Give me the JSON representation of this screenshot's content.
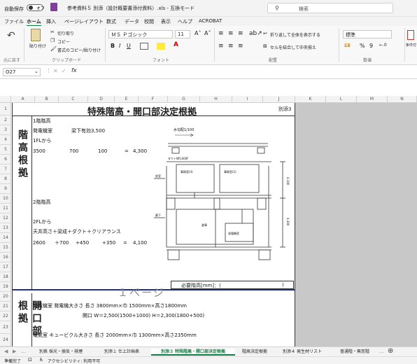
{
  "titlebar": {
    "autosave_label": "自動保存",
    "autosave_state": "オフ",
    "filename": "参考資料５ 別添（設計概要書添付資料）.xls  -  互換モード",
    "search_placeholder": "検索"
  },
  "menu": [
    "ファイル",
    "ホーム",
    "挿入",
    "ページレイアウト",
    "数式",
    "データ",
    "校閲",
    "表示",
    "ヘルプ",
    "ACROBAT"
  ],
  "ribbon": {
    "undo_label": "元に戻す",
    "paste_label": "貼り付け",
    "cut_label": "切り取り",
    "copy_label": "コピー",
    "format_painter_label": "書式のコピー/貼り付け",
    "clipboard_label": "クリップボード",
    "font_name": "ＭＳ Ｐゴシック",
    "font_size": "11",
    "font_label": "フォント",
    "bold": "B",
    "italic": "I",
    "underline": "U",
    "wrap_label": "折り返して全体を表示する",
    "merge_label": "セルを結合して中央揃え",
    "align_label": "配置",
    "number_format": "標準",
    "number_label": "数値",
    "conditional_label": "条件付き書式"
  },
  "formulabar": {
    "name_box": "O27",
    "fx": "fx"
  },
  "columns": [
    "A",
    "B",
    "C",
    "D",
    "E",
    "F",
    "G",
    "H",
    "I",
    "J",
    "K",
    "L",
    "M",
    "N"
  ],
  "rows": [
    "1",
    "2",
    "3",
    "4",
    "5",
    "6",
    "7",
    "8",
    "9",
    "10",
    "11",
    "12",
    "13",
    "14",
    "15",
    "16",
    "17",
    "18",
    "19",
    "20",
    "21",
    "22",
    "23",
    "24"
  ],
  "sheet": {
    "title": "特殊階高・開口部決定根拠",
    "annex": "別添3",
    "section1_label": "階高根拠",
    "section2_label": "開口部根拠",
    "lines": {
      "r3": "1階階高",
      "r4": "発電機室",
      "r4b": "梁下有効3,500",
      "r5": "1FLから",
      "r6a": "3500",
      "r6b": "700",
      "r6c": "100",
      "r6d": "=",
      "r6e": "4,300",
      "r11": "2階階高",
      "r13": "2FLから",
      "r14": "天井高さ＋梁成＋ダクト＋クリアランス",
      "r15a": "2600",
      "r15b": "＋700",
      "r15c": "+450",
      "r15d": "+350",
      "r15e": "=",
      "r15f": "4,100",
      "required": "必要階高[mm]：(",
      "required_end": ")",
      "watermark": "１ページ",
      "r21": "発電機室  発電機大きさ  長さ 3800mm×巾 1500mm×高さ1800mm",
      "r22": "開口  W＝2,500(1500+1000)  H＝2,300(1800+500)",
      "r24": "電気室  キュービクル大きさ    長さ  2000mm×巾 1300mm×高さ2350mm"
    },
    "drawing": {
      "title": "水勾配1/100",
      "room1": "事務室(4)",
      "room2": "事務室(2)",
      "room3": "倉庫",
      "room4": "発電機室",
      "left1": "前室",
      "left2": "廊下",
      "duct": "ダクトNFL600F",
      "dim1": "4,100",
      "dim2": "4,300"
    }
  },
  "tabs": [
    "別表 採光・換気・排煙",
    "別添１ 仕上計画表",
    "別添３ 特殊階高・開口部決定根拠",
    "階高決定根拠",
    "別添４ 発生材リスト",
    "普通階・無窓階"
  ],
  "active_tab": "別添３ 特殊階高・開口部決定根拠",
  "status": {
    "ready": "準備完了",
    "accessibility": "アクセシビリティ: 利用不可"
  },
  "colors": {
    "accent_green": "#107c41",
    "border_blue": "#1f2f8a",
    "tab_active": "#107c41"
  }
}
